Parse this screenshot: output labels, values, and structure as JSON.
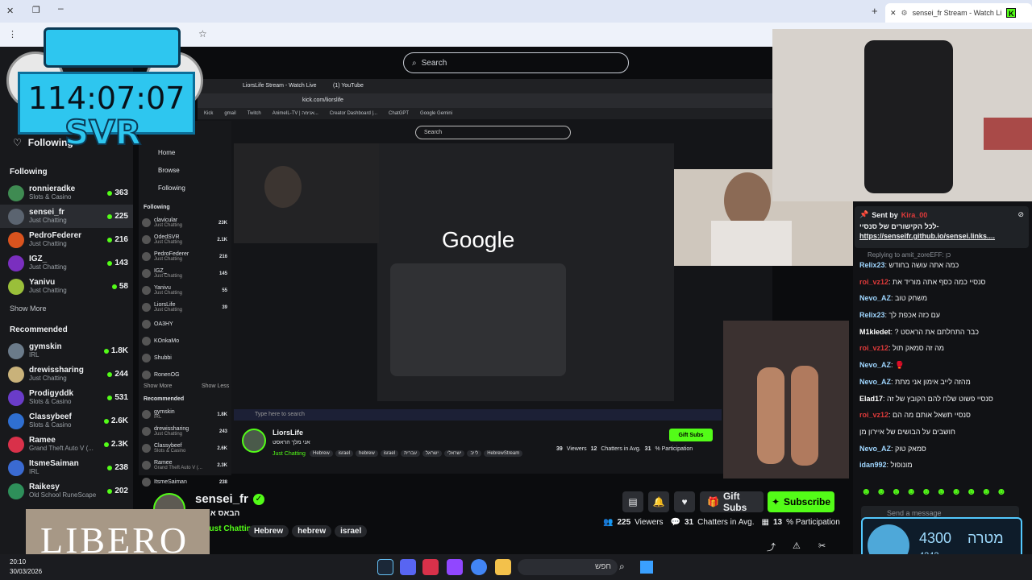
{
  "browser": {
    "tab_title": "sensei_fr Stream - Watch Li",
    "bookmark_icon": "star-icon"
  },
  "overlay": {
    "timer": "114:07:07",
    "svr_label": "SVR",
    "brand_banner": "LIBERO",
    "goal_value": "4300",
    "goal_label": "מטרה",
    "goal_sub": "4242"
  },
  "site": {
    "search_placeholder": "Search",
    "following_label": "Following"
  },
  "sidebar": {
    "following_heading": "Following",
    "following": [
      {
        "name": "ronnieradke",
        "category": "Slots & Casino",
        "viewers": "363",
        "color": "#3f8b52"
      },
      {
        "name": "sensei_fr",
        "category": "Just Chatting",
        "viewers": "225",
        "color": "#5b6470"
      },
      {
        "name": "PedroFederer",
        "category": "Just Chatting",
        "viewers": "216",
        "color": "#d9531e"
      },
      {
        "name": "IGZ_",
        "category": "Just Chatting",
        "viewers": "143",
        "color": "#7a2fbf"
      },
      {
        "name": "Yanivu",
        "category": "Just Chatting",
        "viewers": "58",
        "color": "#9abf3a"
      }
    ],
    "show_more": "Show More",
    "recommended_heading": "Recommended",
    "recommended": [
      {
        "name": "gymskin",
        "category": "IRL",
        "viewers": "1.8K",
        "color": "#6b7b8a"
      },
      {
        "name": "drewissharing",
        "category": "Just Chatting",
        "viewers": "244",
        "color": "#c9b27a"
      },
      {
        "name": "Prodigyddk",
        "category": "Slots & Casino",
        "viewers": "531",
        "color": "#6a3cc9"
      },
      {
        "name": "Classybeef",
        "category": "Slots & Casino",
        "viewers": "2.6K",
        "color": "#2f6fd1"
      },
      {
        "name": "Ramee",
        "category": "Grand Theft Auto V (...",
        "viewers": "2.3K",
        "color": "#d9314a"
      },
      {
        "name": "ItsmeSaiman",
        "category": "IRL",
        "viewers": "238",
        "color": "#3a6ad1"
      },
      {
        "name": "Raikesy",
        "category": "Old School RuneScape",
        "viewers": "202",
        "color": "#2e8f5a"
      }
    ]
  },
  "inner": {
    "tabs": [
      "LiorsLife Stream - Watch Live",
      "(1) YouTube"
    ],
    "url": "kick.com/liorslife",
    "bookmarks": [
      "Kick",
      "gmail",
      "Twitch",
      "AnimeIL-TV | אנימה...",
      "Creator Dashboard |...",
      "ChatGPT",
      "Google Gemini"
    ],
    "search_placeholder": "Search",
    "nav": [
      "Home",
      "Browse",
      "Following"
    ],
    "following_heading": "Following",
    "following": [
      {
        "name": "clavicular",
        "category": "Just Chatting",
        "viewers": "23K"
      },
      {
        "name": "OdedSVR",
        "category": "Just Chatting",
        "viewers": "2.1K"
      },
      {
        "name": "PedroFederer",
        "category": "Just Chatting",
        "viewers": "216"
      },
      {
        "name": "IGZ_",
        "category": "Just Chatting",
        "viewers": "145"
      },
      {
        "name": "Yanivu",
        "category": "Just Chatting",
        "viewers": "55"
      },
      {
        "name": "LiorsLife",
        "category": "Just Chatting",
        "viewers": "39"
      },
      {
        "name": "OA3HY",
        "category": "",
        "viewers": ""
      },
      {
        "name": "KOnkaMo",
        "category": "",
        "viewers": ""
      },
      {
        "name": "Shubbi",
        "category": "",
        "viewers": ""
      },
      {
        "name": "RonenOG",
        "category": "",
        "viewers": ""
      }
    ],
    "show_more": "Show More",
    "show_less": "Show Less",
    "recommended_heading": "Recommended",
    "recommended": [
      {
        "name": "gymskin",
        "category": "IRL",
        "viewers": "1.8K"
      },
      {
        "name": "drewissharing",
        "category": "Just Chatting",
        "viewers": "243"
      },
      {
        "name": "Classybeef",
        "category": "Slots & Casino",
        "viewers": "2.6K"
      },
      {
        "name": "Ramee",
        "category": "Grand Theft Auto V (...",
        "viewers": "2.3K"
      },
      {
        "name": "ItsmeSaiman",
        "category": "",
        "viewers": "238"
      }
    ],
    "google_logo": "Google",
    "streamer": "LiorsLife",
    "stream_title": "אני מלך הראסט",
    "category": "Just Chatting",
    "tags": [
      "Hebrew",
      "israel",
      "hebrew",
      "israel",
      "עברית",
      "ישראל",
      "ישראלי",
      "לייב",
      "HebrewStream"
    ],
    "viewers": "39",
    "viewers_label": "Viewers",
    "chatters": "12",
    "chatters_label": "Chatters in Avg.",
    "participation": "31",
    "participation_label": "% Participation",
    "gift_subs": "Gift Subs",
    "taskbar_search": "Type here to search"
  },
  "stream": {
    "streamer": "sensei_fr",
    "title": "הבאס איז בי",
    "category": "Just Chatting",
    "tags": [
      "Hebrew",
      "hebrew",
      "israel"
    ],
    "viewers": "225",
    "viewers_label": "Viewers",
    "chatters": "31",
    "chatters_label": "Chatters in Avg.",
    "participation": "13",
    "participation_label": "% Participation",
    "gift_subs": "Gift Subs",
    "subscribe": "Subscribe"
  },
  "chat": {
    "pinned_sender_label": "Sent by",
    "pinned_sender": "Kira_00",
    "pinned_text": "-לכל הקישורים של סנסיי",
    "pinned_link": "https://senseifr.github.io/sensei.links....",
    "reply_note": "Replying to amit_zoreEFF: כן",
    "messages": [
      {
        "user": "Relix23",
        "color": "#9fd6ff",
        "text": "כמה אתה עושה בחודש"
      },
      {
        "user": "roi_vz12",
        "color": "#e03a3a",
        "text": "סנסיי כמה כסף אתה מוריד את"
      },
      {
        "user": "Nevo_AZ",
        "color": "#9fd6ff",
        "text": "משחק טוב"
      },
      {
        "user": "Relix23",
        "color": "#9fd6ff",
        "text": "עם כזה אכפת לך"
      },
      {
        "user": "M1kledet",
        "color": "#ffffff",
        "text": "? כבר התחלתם את הראסט"
      },
      {
        "user": "roi_vz12",
        "color": "#e03a3a",
        "text": "מה זה סמאק תול"
      },
      {
        "user": "Nevo_AZ",
        "color": "#9fd6ff",
        "text": "🥊"
      },
      {
        "user": "Nevo_AZ",
        "color": "#9fd6ff",
        "text": "מהזה לייב אימון אני מתת"
      },
      {
        "user": "Elad17",
        "color": "#ffffff",
        "text": "סנסיי פשוט שלח להם הקובץ של זה"
      },
      {
        "user": "roi_vz12",
        "color": "#e03a3a",
        "text": "סנסיי תשאל אותם מה הם"
      },
      {
        "user": "",
        "color": "#ffffff",
        "text": "חושבים על הבושים של איירון מן"
      },
      {
        "user": "Nevo_AZ",
        "color": "#9fd6ff",
        "text": "סמאק טוק"
      },
      {
        "user": "idan992",
        "color": "#9fd6ff",
        "text": "מונופול"
      }
    ],
    "send_placeholder": "Send a message"
  },
  "taskbar": {
    "search": "חפש",
    "time": "20:10",
    "date": "30/03/2026"
  }
}
